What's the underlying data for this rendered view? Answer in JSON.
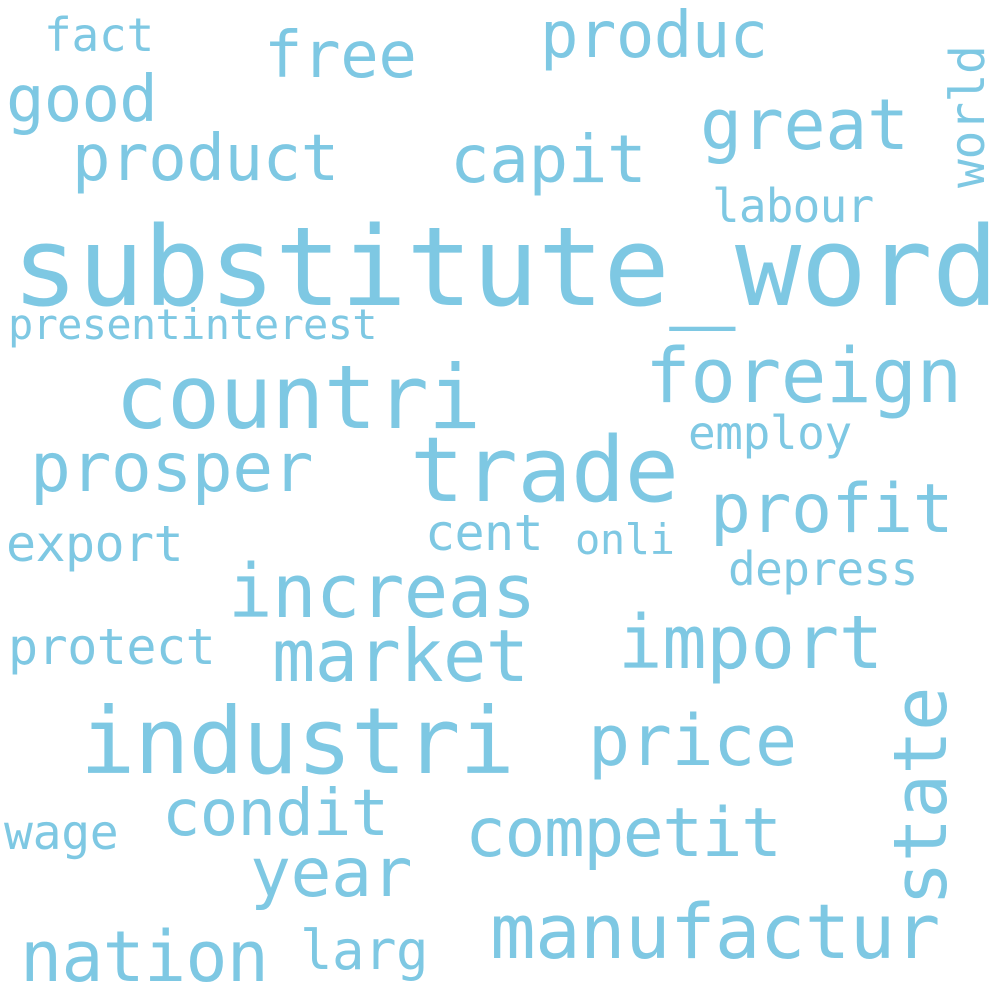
{
  "word_color": "#7ec8e3",
  "background": "#ffffff",
  "words": {
    "substitute_word": "substitute_word",
    "countri": "countri",
    "trade": "trade",
    "industri": "industri",
    "foreign": "foreign",
    "increas": "increas",
    "market": "market",
    "import": "import",
    "manufactur": "manufactur",
    "prosper": "prosper",
    "profit": "profit",
    "product": "product",
    "capit": "capit",
    "produc": "produc",
    "great": "great",
    "good": "good",
    "free": "free",
    "price": "price",
    "competit": "competit",
    "nation": "nation",
    "year": "year",
    "condit": "condit",
    "state": "state",
    "presentinterest": "presentinterest",
    "export": "export",
    "protect": "protect",
    "depress": "depress",
    "labour": "labour",
    "world": "world",
    "employ": "employ",
    "cent": "cent",
    "onli": "onli",
    "wage": "wage",
    "larg": "larg",
    "fact": "fact"
  }
}
